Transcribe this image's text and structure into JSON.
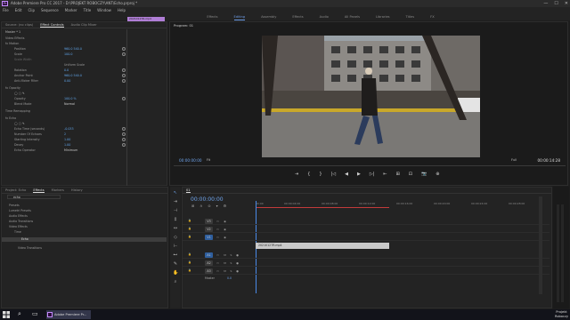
{
  "window": {
    "title": "Adobe Premiere Pro CC 2017 - D:\\PROJEKT ROBOCZY\\ANT\\Echo.prproj *",
    "controls": [
      "—",
      "☐",
      "✕"
    ]
  },
  "menu": [
    "File",
    "Edit",
    "Clip",
    "Sequence",
    "Marker",
    "Title",
    "Window",
    "Help"
  ],
  "workspaces": [
    "Effects",
    "Editing",
    "Assembly",
    "Effects",
    "Audio",
    "All Panels",
    "Libraries",
    "Titles",
    "FX"
  ],
  "effect_controls": {
    "tabs": [
      "Source: (no clips)",
      "Effect Controls",
      "Audio Clip Mixer"
    ],
    "master": "Master * 1",
    "clip_label": "20210127R.mp4",
    "rows": [
      {
        "label": "Video Effects",
        "value": ""
      },
      {
        "label": "fx  Motion",
        "value": ""
      },
      {
        "label": "Position",
        "value": "960.0    540.0"
      },
      {
        "label": "Scale",
        "value": "100.0"
      },
      {
        "label": "Scale Width",
        "value": ""
      },
      {
        "label": "",
        "value": "Uniform Scale"
      },
      {
        "label": "Rotation",
        "value": "0.0"
      },
      {
        "label": "Anchor Point",
        "value": "960.0    540.0"
      },
      {
        "label": "Anti-flicker Filter",
        "value": "0.00"
      },
      {
        "label": "fx  Opacity",
        "value": ""
      },
      {
        "label": "",
        "value": ""
      },
      {
        "label": "Opacity",
        "value": "100.0 %"
      },
      {
        "label": "Blend Mode",
        "value": "Normal"
      },
      {
        "label": "Time Remapping",
        "value": ""
      },
      {
        "label": "fx  Echo",
        "value": ""
      },
      {
        "label": "",
        "value": ""
      },
      {
        "label": "Echo Time (seconds)",
        "value": "-0.033"
      },
      {
        "label": "Number Of Echoes",
        "value": "2"
      },
      {
        "label": "Starting Intensity",
        "value": "1.00"
      },
      {
        "label": "Decay",
        "value": "1.00"
      },
      {
        "label": "Echo Operator",
        "value": "Minimum"
      }
    ]
  },
  "program": {
    "title": "Program: 01",
    "timecode_left": "00:00:00:00",
    "fit": "Fit",
    "full": "Full",
    "timecode_right": "00:00:14:28",
    "transport": [
      "⇥",
      "{",
      "}",
      "|◁",
      "◀",
      "▶",
      "▷|",
      "⇤",
      "⊞",
      "⊡",
      "📷",
      "⊕"
    ]
  },
  "effects_browser": {
    "tabs": [
      "Project: Echo",
      "Effects",
      "Markers",
      "History"
    ],
    "search_value": "echo",
    "items": [
      "Presets",
      "Lumetri Presets",
      "Audio Effects",
      "Audio Transitions",
      "Video Effects",
      "Time",
      "Echo",
      "Video Transitions"
    ]
  },
  "timeline": {
    "tab": "01",
    "timecode": "00:00:00:00",
    "ruler": [
      "00:00",
      "00:00:04:00",
      "00:00:08:00",
      "00:00:12:00",
      "00:00:16:00",
      "00:00:20:00",
      "00:00:24:00",
      "00:00:28:00"
    ],
    "video_tracks": [
      "V3",
      "V2",
      "V1"
    ],
    "audio_tracks": [
      "A1",
      "A2",
      "A3"
    ],
    "master_label": "Master",
    "master_value": "0.0",
    "clip_name": "20210127R.mp4"
  },
  "taskbar": {
    "app_label": "Adobe Premiere Pr...",
    "clock_line1": "Projekt",
    "clock_line2": "Roboczy"
  }
}
